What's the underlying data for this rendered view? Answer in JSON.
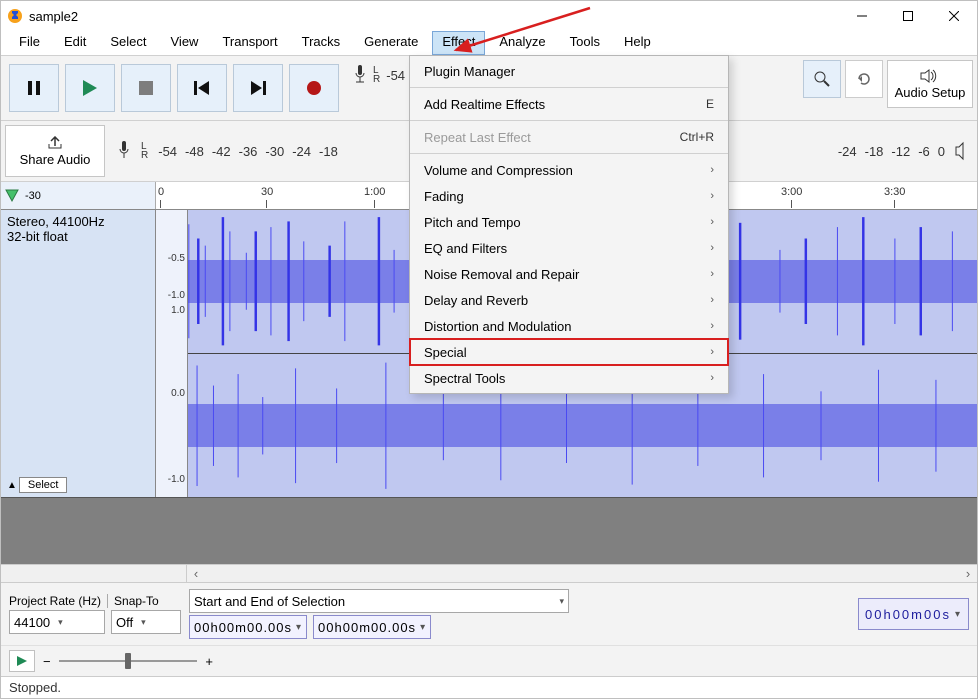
{
  "window": {
    "title": "sample2"
  },
  "menus": {
    "file": "File",
    "edit": "Edit",
    "select": "Select",
    "view": "View",
    "transport": "Transport",
    "tracks": "Tracks",
    "generate": "Generate",
    "effect": "Effect",
    "analyze": "Analyze",
    "tools": "Tools",
    "help": "Help"
  },
  "effect_menu": {
    "plugin_manager": "Plugin Manager",
    "realtime": "Add Realtime Effects",
    "realtime_sc": "E",
    "repeat": "Repeat Last Effect",
    "repeat_sc": "Ctrl+R",
    "volume": "Volume and Compression",
    "fading": "Fading",
    "pitch": "Pitch and Tempo",
    "eq": "EQ and Filters",
    "noise": "Noise Removal and Repair",
    "delay": "Delay and Reverb",
    "distort": "Distortion and Modulation",
    "special": "Special",
    "spectral": "Spectral Tools"
  },
  "toolbar": {
    "audio_setup": "Audio Setup",
    "share": "Share Audio"
  },
  "meter": {
    "ticks": [
      "-54",
      "-48",
      "-42",
      "-36",
      "-30",
      "-24",
      "-18"
    ],
    "ticks2": [
      "-24",
      "-18",
      "-12",
      "-6",
      "0"
    ]
  },
  "timeline": {
    "t0": "-30",
    "t1": "0",
    "t2": "30",
    "t3": "1:00",
    "t4": "3:00",
    "t5": "3:30"
  },
  "track": {
    "info_l1": "Stereo, 44100Hz",
    "info_l2": "32-bit float",
    "select_btn": "Select",
    "scale_top": [
      "-0.5",
      "-1.0"
    ],
    "scale_bot": [
      "1.0",
      "0.0",
      "-1.0"
    ]
  },
  "selection": {
    "project_rate_lbl": "Project Rate (Hz)",
    "project_rate_val": "44100",
    "snap_lbl": "Snap-To",
    "snap_val": "Off",
    "range_label": "Start and End of Selection",
    "t1": "00h00m00.00s",
    "t2": "00h00m00.00s",
    "pos": "00h00m00s"
  },
  "zoom": {
    "minus": "−",
    "plus": "+"
  },
  "status": {
    "text": "Stopped."
  }
}
